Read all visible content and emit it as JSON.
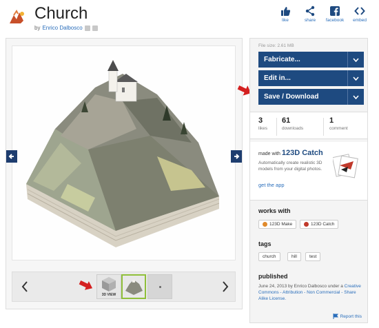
{
  "header": {
    "title": "Church",
    "by_prefix": "by",
    "author": "Enrico Dalbosco"
  },
  "share": [
    {
      "label": "like",
      "icon": "thumbs-up-icon"
    },
    {
      "label": "share",
      "icon": "share-icon"
    },
    {
      "label": "facebook",
      "icon": "facebook-icon"
    },
    {
      "label": "embed",
      "icon": "embed-icon"
    }
  ],
  "viewer": {
    "thumb_3d_label": "3D VIEW"
  },
  "sidebar": {
    "file_size": "File size: 2.61 MB",
    "buttons": {
      "fabricate": "Fabricate...",
      "edit": "Edit in...",
      "save": "Save / Download"
    },
    "stats": [
      {
        "value": "3",
        "caption": "likes"
      },
      {
        "value": "61",
        "caption": "downloads"
      },
      {
        "value": "1",
        "caption": "comment"
      }
    ],
    "promo": {
      "made_with": "made with",
      "app_name": "123D Catch",
      "description": "Automatically create realistic 3D models from your digital photos.",
      "get_app": "get the app"
    },
    "works_with": {
      "heading": "works with",
      "apps": [
        "123D Make",
        "123D Catch"
      ]
    },
    "tags": {
      "heading": "tags",
      "items": [
        "church",
        "hill",
        "test"
      ]
    },
    "published": {
      "heading": "published",
      "text_prefix": "June 24, 2013 by Enrico Dalbosco under a",
      "license": "Creative Commons - Attribution - Non Commercial - Share Alike License."
    },
    "report": "Report this"
  },
  "colors": {
    "button_blue": "#1e4a80",
    "link_blue": "#2a6ebb",
    "selected_thumb": "#8fbf3a",
    "annotation_red": "#d42020"
  }
}
